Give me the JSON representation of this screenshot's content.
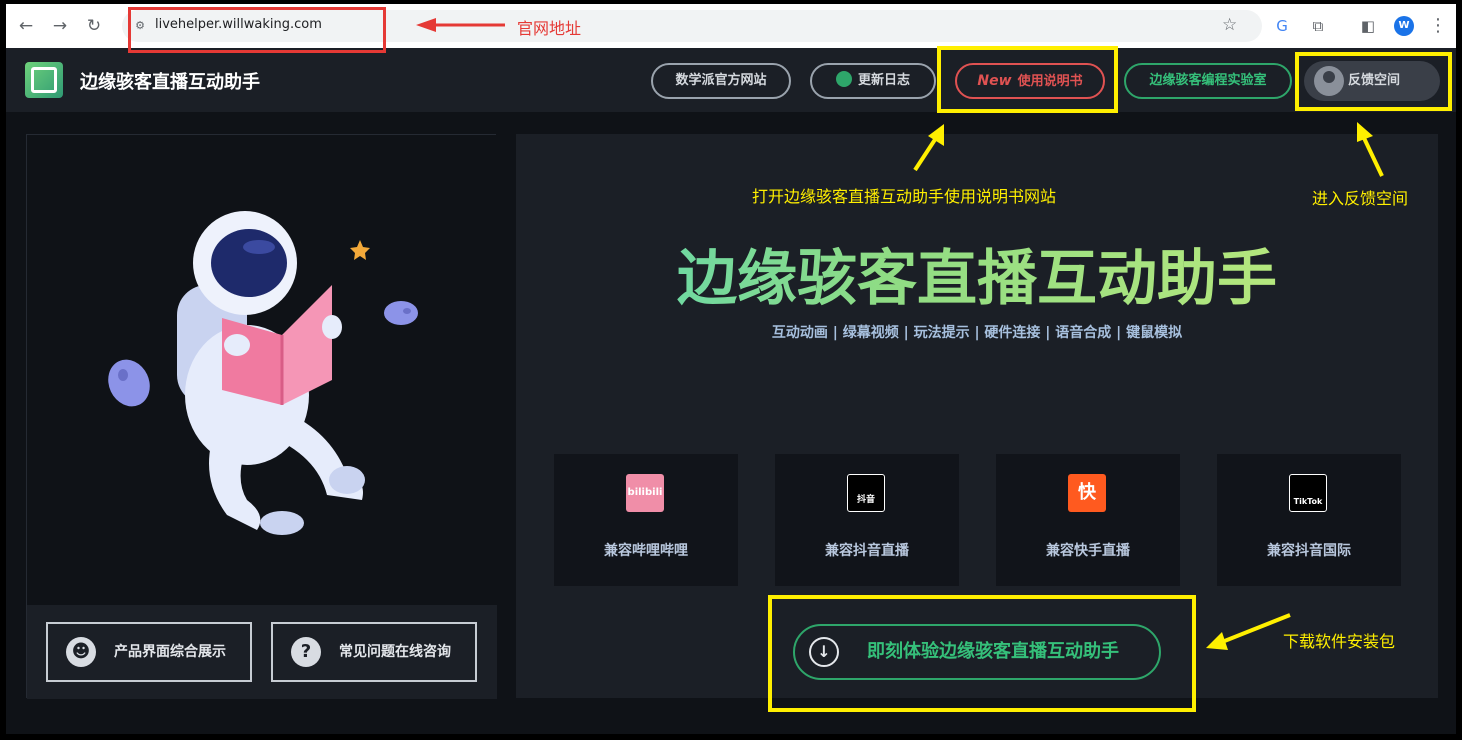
{
  "browser": {
    "url": "livehelper.willwaking.com",
    "profile_initial": "W",
    "icons": [
      "back-icon",
      "forward-icon",
      "reload-icon",
      "site-info-icon",
      "star-icon",
      "translate-icon",
      "extensions-icon",
      "sidebar-icon",
      "profile-avatar",
      "menu-icon"
    ]
  },
  "header": {
    "site_title": "边缘骇客直播互动助手",
    "nav": {
      "math_site": "数学派官方网站",
      "changelog": "更新日志",
      "manual_badge": "New",
      "manual": "使用说明书",
      "lab": "边缘骇客编程实验室",
      "feedback": "反馈空间"
    }
  },
  "left_panel": {
    "showcase": "产品界面综合展示",
    "faq": "常见问题在线咨询"
  },
  "hero": {
    "title": "边缘骇客直播互动助手",
    "subtitle": "互动动画 | 绿幕视频 | 玩法提示 | 硬件连接 | 语音合成 | 键鼠模拟"
  },
  "platforms": [
    {
      "label": "兼容哔哩哔哩",
      "icon": "bilibili-icon",
      "icon_text": "bilibili",
      "color": "#f08ea8"
    },
    {
      "label": "兼容抖音直播",
      "icon": "douyin-icon",
      "icon_text": "抖音",
      "color": "#000000"
    },
    {
      "label": "兼容快手直播",
      "icon": "kuaishou-icon",
      "icon_text": "快",
      "color": "#ff5a1f"
    },
    {
      "label": "兼容抖音国际",
      "icon": "tiktok-icon",
      "icon_text": "TikTok",
      "color": "#000000"
    }
  ],
  "download": {
    "label": "即刻体验边缘骇客直播互动助手"
  },
  "annotations": {
    "url_note": "官网地址",
    "manual_note": "打开边缘骇客直播互动助手使用说明书网站",
    "feedback_note": "进入反馈空间",
    "download_note": "下载软件安装包"
  },
  "colors": {
    "annotation_yellow": "#ffef00",
    "annotation_red": "#e53935",
    "accent_green": "#35c07a",
    "manual_red": "#e05252"
  }
}
